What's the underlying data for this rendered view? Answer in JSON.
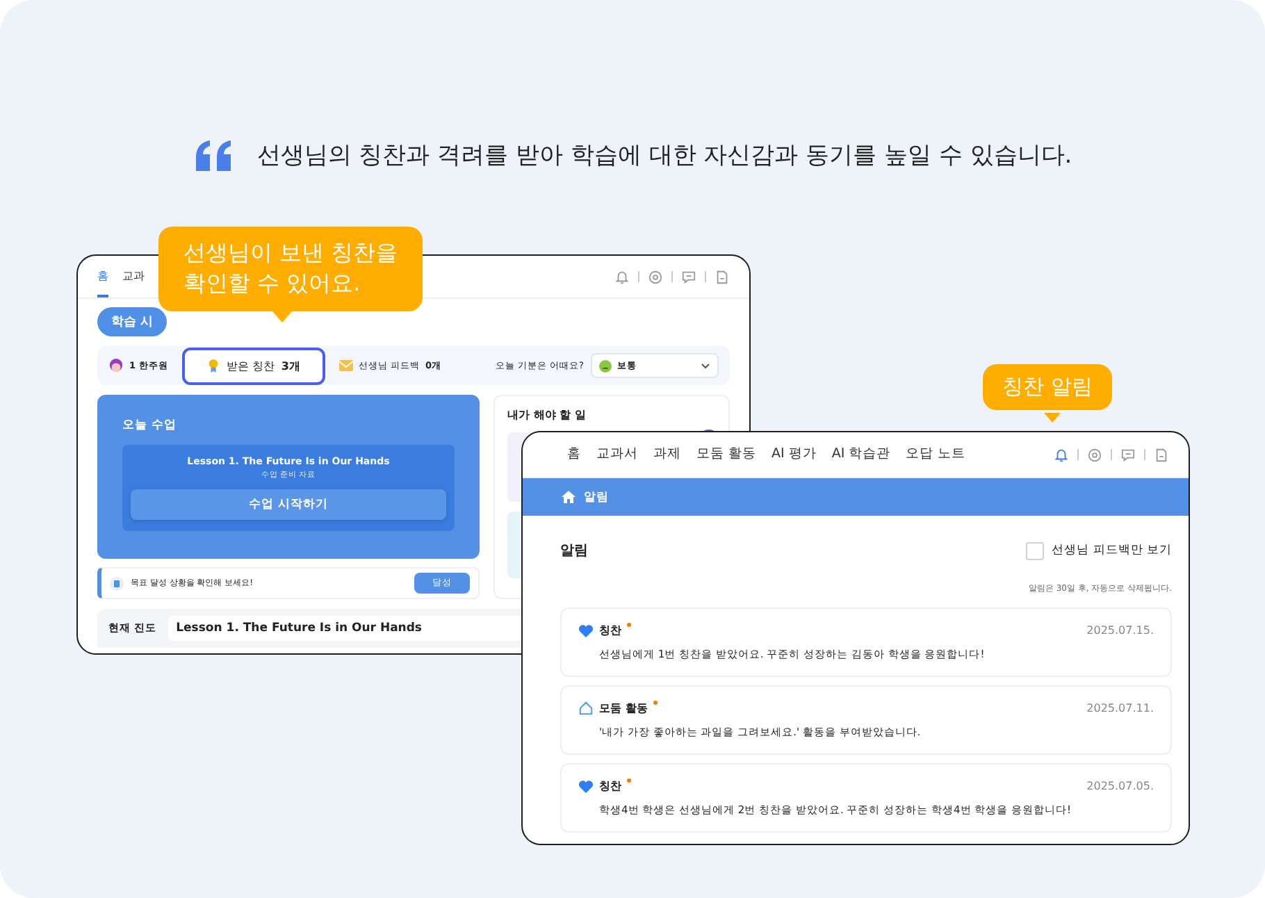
{
  "headline": "선생님의 칭찬과 격려를 받아 학습에 대한 자신감과 동기를 높일 수 있습니다.",
  "callouts": [
    {
      "text": "선생님이 보낸 칭찬을\n확인할 수 있어요."
    },
    {
      "text": "칭찬 알림"
    }
  ],
  "dashboard": {
    "tabs": [
      {
        "label": "홈",
        "selected": true
      },
      {
        "label": "교과",
        "selected": false
      }
    ],
    "start_button": "학습 시",
    "student": "1 한주원",
    "praise": {
      "label": "받은 칭찬",
      "count": "3개",
      "highlighted": true
    },
    "feedback": {
      "label": "선생님 피드백",
      "count": "0개"
    },
    "mood": {
      "question": "오늘 기분은 어때요?",
      "value": "보통"
    },
    "today": {
      "title": "오늘 수업",
      "lesson": "Lesson 1. The Future Is in Our Hands",
      "subtitle": "수업 준비 자료",
      "button": "수업 시작하기"
    },
    "todo_title": "내가 해야 할 일",
    "goal": {
      "text": "목표 달성 상황을 확인해 보세요!",
      "button": "달성"
    },
    "progress": {
      "label": "현재 진도",
      "value": "Lesson 1. The Future Is in Our Hands"
    }
  },
  "notifications": {
    "nav": [
      "홈",
      "교과서",
      "과제",
      "모둠 활동",
      "AI 평가",
      "AI 학습관",
      "오답 노트"
    ],
    "icons": [
      {
        "kind": "bell",
        "active": true
      },
      {
        "kind": "gear",
        "active": false
      },
      {
        "kind": "chat",
        "active": false
      },
      {
        "kind": "note",
        "active": false
      }
    ],
    "breadcrumb": "알림",
    "title": "알림",
    "filter": {
      "label": "선생님 피드백만 보기",
      "checked": false
    },
    "notice": "알림은 30일 후, 자동으로 삭제됩니다.",
    "items": [
      {
        "kind": "praise",
        "title": "칭찬",
        "unread": true,
        "date": "2025.07.15.",
        "body": "선생님에게 1번 칭찬을 받았어요. 꾸준히 성장하는 김동아 학생을 응원합니다!"
      },
      {
        "kind": "group",
        "title": "모둠 활동",
        "unread": true,
        "date": "2025.07.11.",
        "body": "'내가 가장 좋아하는 과일을 그려보세요.' 활동을 부여받았습니다."
      },
      {
        "kind": "praise",
        "title": "칭찬",
        "unread": true,
        "date": "2025.07.05.",
        "body": "학생4번 학생은 선생님에게 2번 칭찬을 받았어요. 꾸준히 성장하는 학생4번 학생을 응원합니다!"
      }
    ]
  }
}
